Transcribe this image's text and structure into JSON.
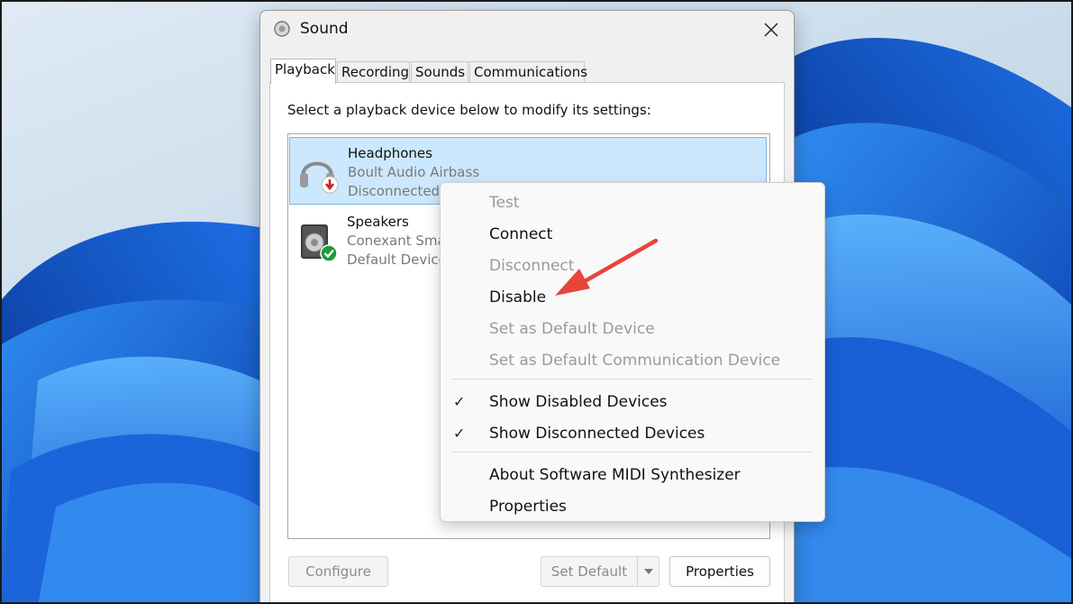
{
  "window": {
    "title": "Sound",
    "close_glyph": "✕"
  },
  "tabs": [
    {
      "label": "Playback",
      "active": true
    },
    {
      "label": "Recording",
      "active": false
    },
    {
      "label": "Sounds",
      "active": false
    },
    {
      "label": "Communications",
      "active": false
    }
  ],
  "instruction": "Select a playback device below to modify its settings:",
  "devices": [
    {
      "name": "Headphones",
      "description": "Boult Audio Airbass",
      "status": "Disconnected",
      "icon": "headphones-icon",
      "badge": "red-down-arrow-badge",
      "selected": true
    },
    {
      "name": "Speakers",
      "description": "Conexant Smar",
      "status": "Default Device",
      "icon": "speaker-icon",
      "badge": "green-check-badge",
      "selected": false
    }
  ],
  "buttons": {
    "configure": "Configure",
    "set_default": "Set Default",
    "properties": "Properties"
  },
  "context_menu": {
    "items": [
      {
        "label": "Test",
        "enabled": false
      },
      {
        "label": "Connect",
        "enabled": true
      },
      {
        "label": "Disconnect",
        "enabled": false
      },
      {
        "label": "Disable",
        "enabled": true
      },
      {
        "label": "Set as Default Device",
        "enabled": false
      },
      {
        "label": "Set as Default Communication Device",
        "enabled": false
      },
      {
        "label": "Show Disabled Devices",
        "enabled": true,
        "checked": true
      },
      {
        "label": "Show Disconnected Devices",
        "enabled": true,
        "checked": true
      },
      {
        "label": "About Software MIDI Synthesizer",
        "enabled": true
      },
      {
        "label": "Properties",
        "enabled": true
      }
    ],
    "check_glyph": "✓"
  },
  "annotation": {
    "color": "#e8443a",
    "points_to": "Disable"
  },
  "colors": {
    "selection": "#cce8ff",
    "selection_border": "#7ab5e6",
    "wallpaper_blue": "#1d5fd6"
  }
}
